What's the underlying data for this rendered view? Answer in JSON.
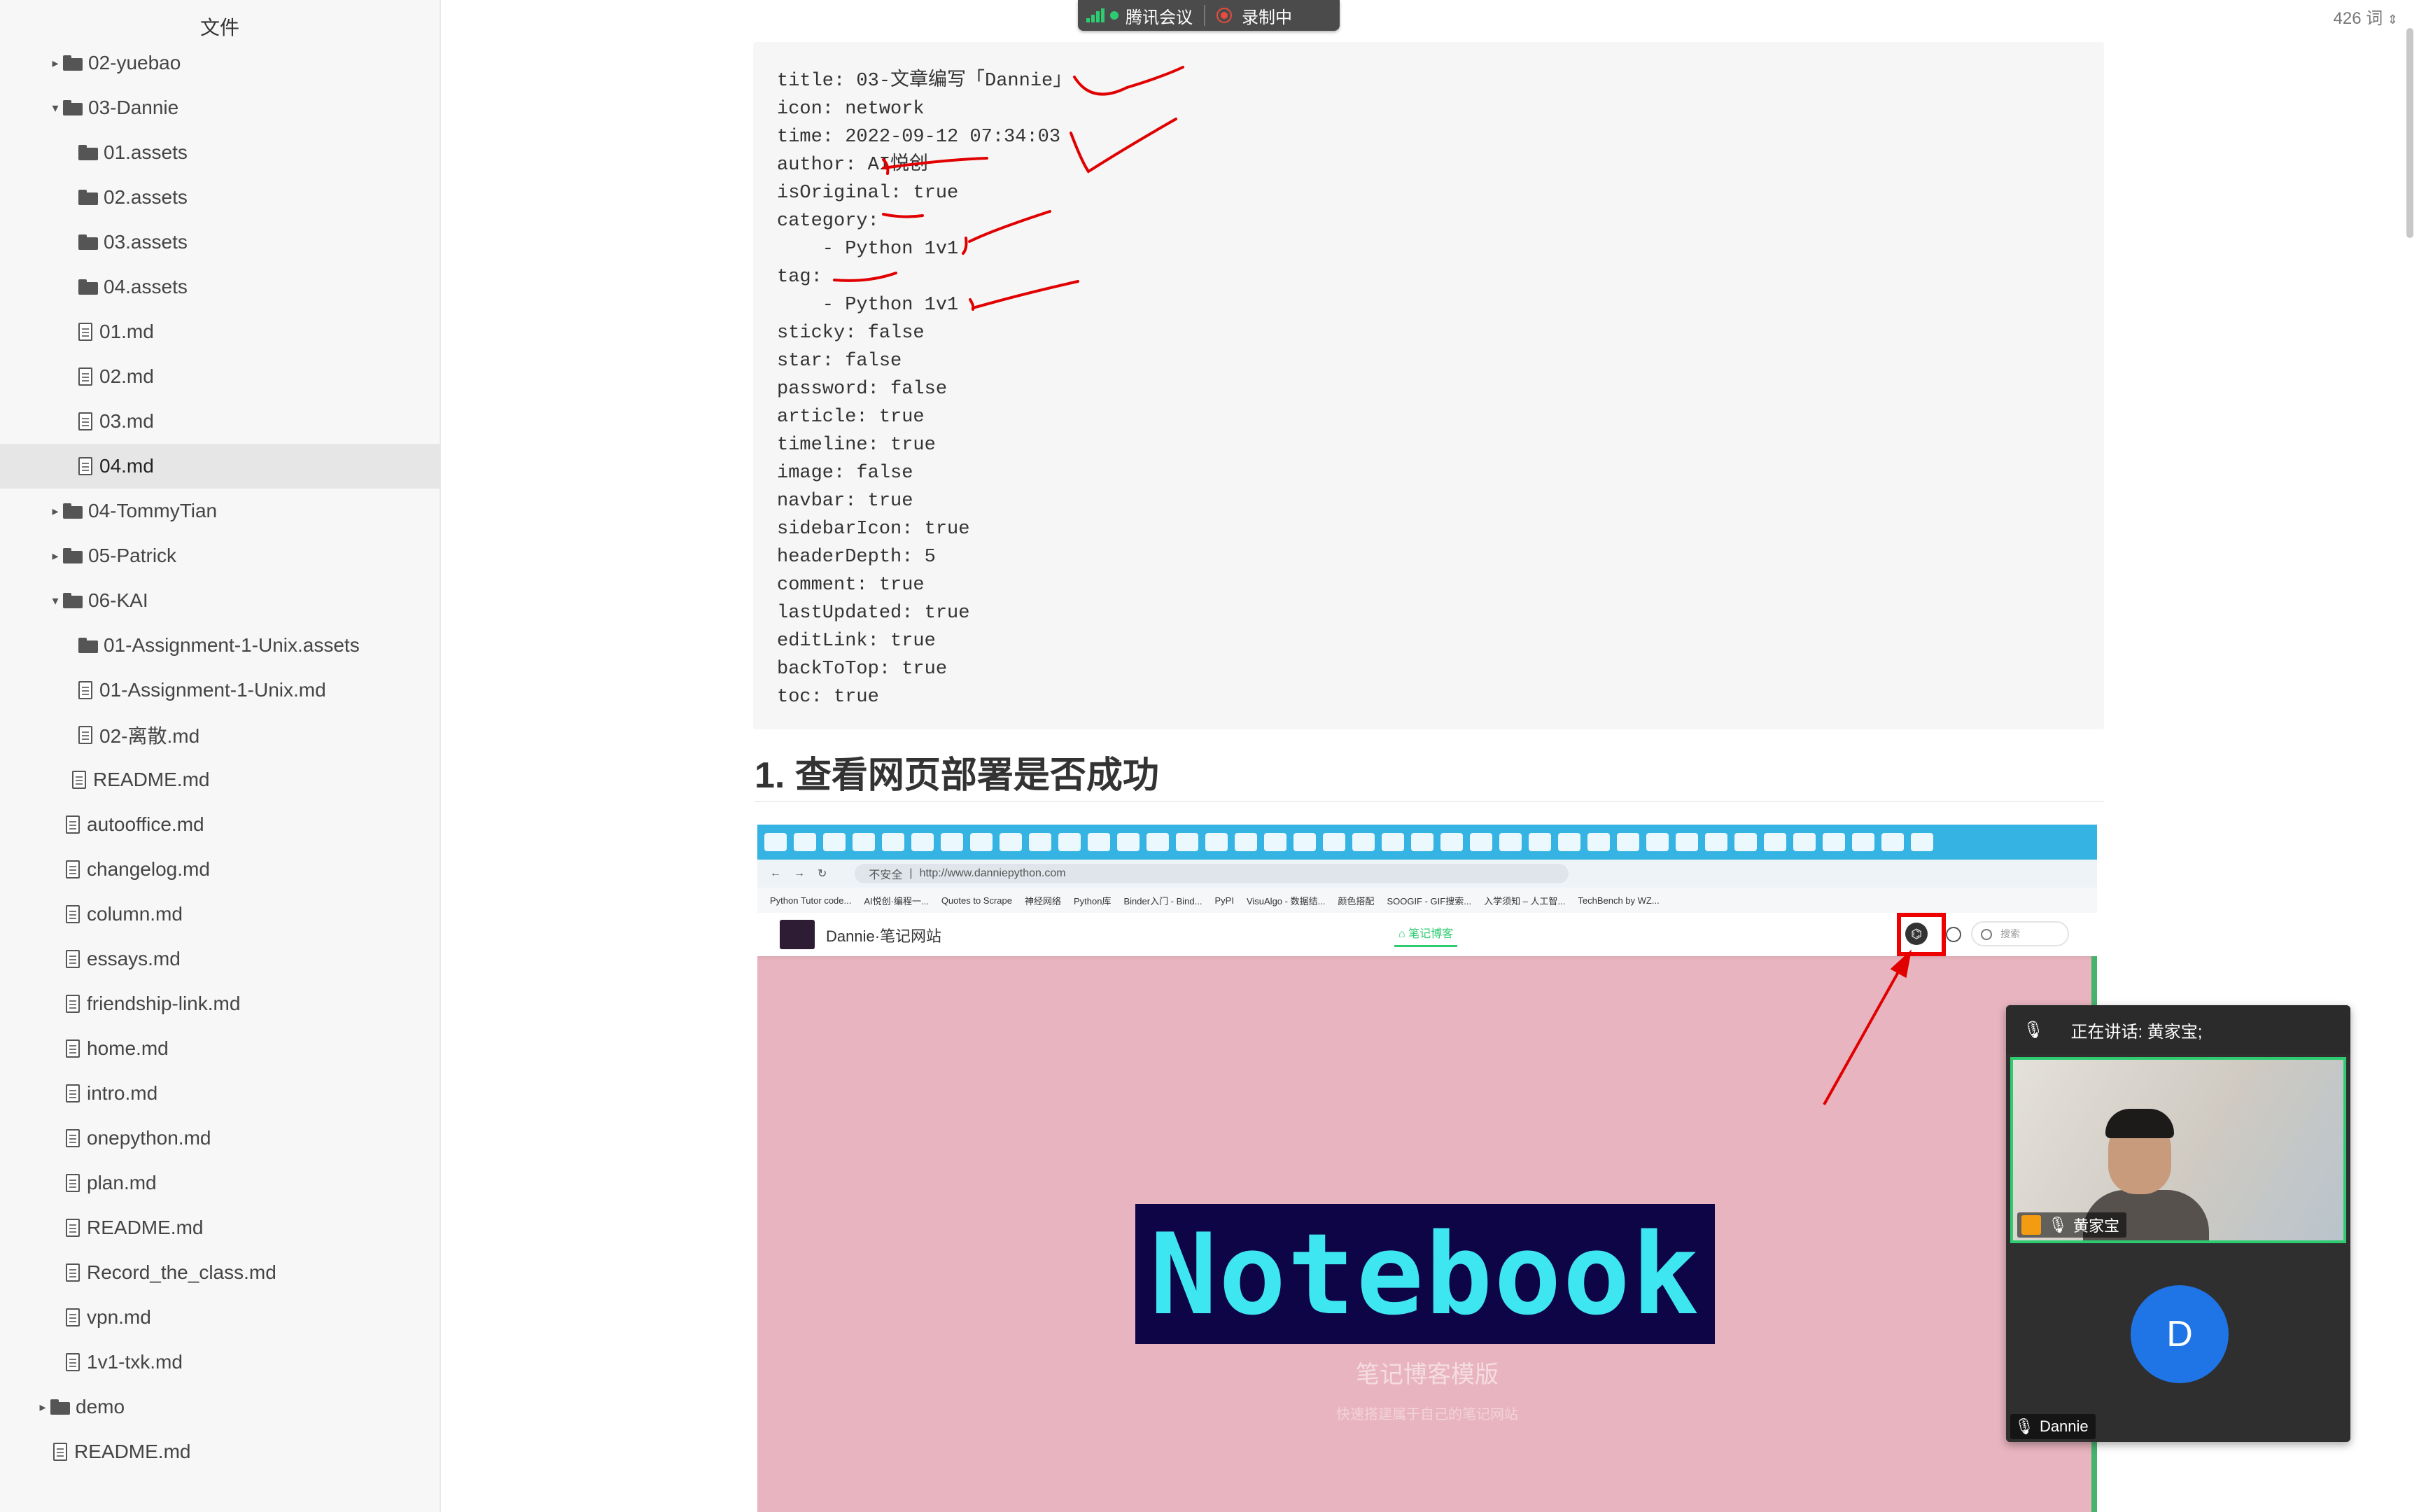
{
  "sidebar": {
    "title": "文件",
    "items": [
      {
        "label": "02-yuebao",
        "kind": "folder",
        "state": "collapsed",
        "depth": 1
      },
      {
        "label": "03-Dannie",
        "kind": "folder",
        "state": "expanded",
        "depth": 1
      },
      {
        "label": "01.assets",
        "kind": "folder",
        "state": "none",
        "depth": 2
      },
      {
        "label": "02.assets",
        "kind": "folder",
        "state": "none",
        "depth": 2
      },
      {
        "label": "03.assets",
        "kind": "folder",
        "state": "none",
        "depth": 2
      },
      {
        "label": "04.assets",
        "kind": "folder",
        "state": "none",
        "depth": 2
      },
      {
        "label": "01.md",
        "kind": "file",
        "depth": 2
      },
      {
        "label": "02.md",
        "kind": "file",
        "depth": 2
      },
      {
        "label": "03.md",
        "kind": "file",
        "depth": 2
      },
      {
        "label": "04.md",
        "kind": "file",
        "depth": 2,
        "selected": true
      },
      {
        "label": "04-TommyTian",
        "kind": "folder",
        "state": "collapsed",
        "depth": 1
      },
      {
        "label": "05-Patrick",
        "kind": "folder",
        "state": "collapsed",
        "depth": 1
      },
      {
        "label": "06-KAI",
        "kind": "folder",
        "state": "expanded",
        "depth": 1
      },
      {
        "label": "01-Assignment-1-Unix.assets",
        "kind": "folder",
        "state": "none",
        "depth": 2
      },
      {
        "label": "01-Assignment-1-Unix.md",
        "kind": "file",
        "depth": 2
      },
      {
        "label": "02-离散.md",
        "kind": "file",
        "depth": 2
      },
      {
        "label": "README.md",
        "kind": "file",
        "depth": 1.5
      },
      {
        "label": "autooffice.md",
        "kind": "file",
        "depth": 1
      },
      {
        "label": "changelog.md",
        "kind": "file",
        "depth": 1
      },
      {
        "label": "column.md",
        "kind": "file",
        "depth": 1
      },
      {
        "label": "essays.md",
        "kind": "file",
        "depth": 1
      },
      {
        "label": "friendship-link.md",
        "kind": "file",
        "depth": 1
      },
      {
        "label": "home.md",
        "kind": "file",
        "depth": 1
      },
      {
        "label": "intro.md",
        "kind": "file",
        "depth": 1
      },
      {
        "label": "onepython.md",
        "kind": "file",
        "depth": 1
      },
      {
        "label": "plan.md",
        "kind": "file",
        "depth": 1
      },
      {
        "label": "README.md",
        "kind": "file",
        "depth": 1
      },
      {
        "label": "Record_the_class.md",
        "kind": "file",
        "depth": 1
      },
      {
        "label": "vpn.md",
        "kind": "file",
        "depth": 1
      },
      {
        "label": "1v1-txk.md",
        "kind": "file",
        "depth": 1
      },
      {
        "label": "demo",
        "kind": "folder",
        "state": "collapsed",
        "depth": 0
      },
      {
        "label": "README.md",
        "kind": "file",
        "depth": 0
      }
    ]
  },
  "meeting_bar": {
    "app_name": "腾讯会议",
    "recording_label": "录制中"
  },
  "status": {
    "word_count": "426 词"
  },
  "code_block": {
    "lines": [
      "title: 03-文章编写「Dannie」",
      "icon: network",
      "time: 2022-09-12 07:34:03",
      "author: AI悦创",
      "isOriginal: true",
      "category:",
      "    - Python 1v1",
      "tag:",
      "    - Python 1v1",
      "sticky: false",
      "star: false",
      "password: false",
      "article: true",
      "timeline: true",
      "image: false",
      "navbar: true",
      "sidebarIcon: true",
      "headerDepth: 5",
      "comment: true",
      "lastUpdated: true",
      "editLink: true",
      "backToTop: true",
      "toc: true"
    ]
  },
  "heading": "1. 查看网页部署是否成功",
  "embedded_screenshot": {
    "url": "http://www.danniepython.com",
    "insecure_label": "不安全",
    "bookmarks": [
      "Python Tutor code...",
      "AI悦创·编程一...",
      "Quotes to Scrape",
      "神经网络",
      "Python库",
      "Binder入门 - Bind...",
      "PyPI",
      "VisuAlgo - 数据结...",
      "颜色搭配",
      "SOOGIF - GIF搜索...",
      "入学须知 – 人工智...",
      "TechBench by WZ..."
    ],
    "site_name": "Dannie·笔记网站",
    "nav_item": "笔记博客",
    "search_placeholder": "搜索",
    "hero_title": "Notebook",
    "hero_subtitle": "笔记博客模版",
    "hero_desc": "快速搭建属于自己的笔记网站",
    "banner_color": "#0e0547",
    "page_color": "#e8b4bf"
  },
  "video_panel": {
    "speaking": "正在讲话: 黄家宝;",
    "participant_cam": "黄家宝",
    "participant_avatar": "Dannie",
    "avatar_letter": "D",
    "avatar_color": "#1f74e6"
  },
  "colors": {
    "annotation_red": "#e00000",
    "speaker_border": "#2ecc71"
  }
}
